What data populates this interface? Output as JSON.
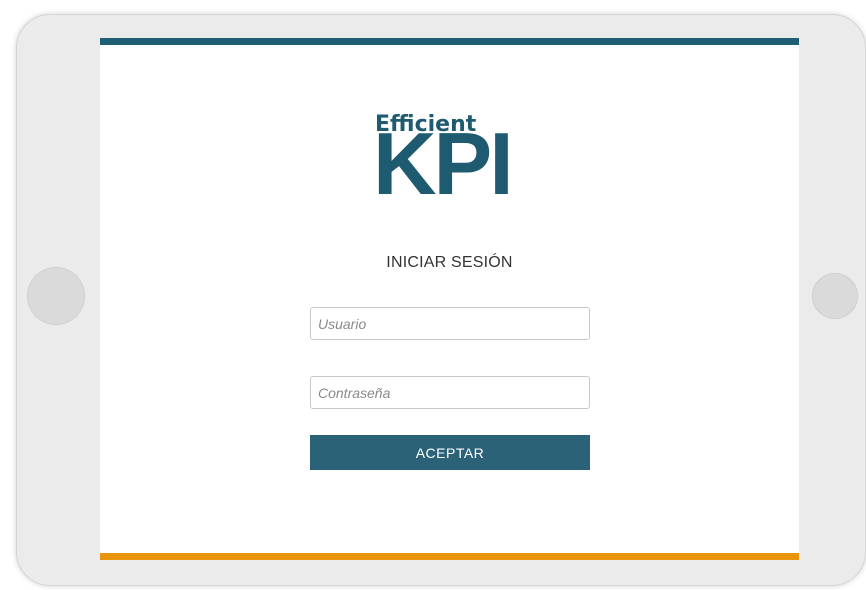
{
  "colors": {
    "brand": "#1e5b70",
    "top_bar": "#1f5f74",
    "bottom_bar": "#e8940c",
    "button_bg": "#2b6278"
  },
  "logo": {
    "small_text": "Efficient",
    "big_text": "KPI"
  },
  "login": {
    "title": "INICIAR SESIÓN",
    "username_placeholder": "Usuario",
    "password_placeholder": "Contraseña",
    "submit_label": "ACEPTAR"
  }
}
